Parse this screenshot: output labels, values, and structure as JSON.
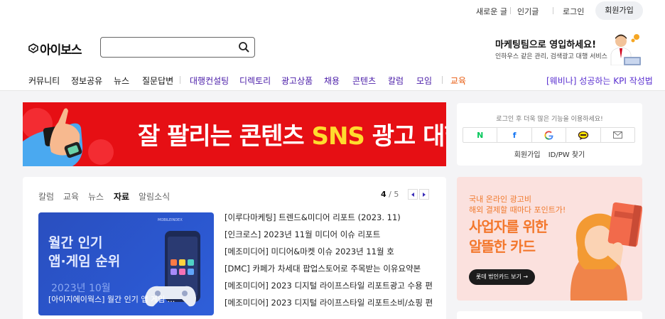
{
  "util": {
    "new_posts": "새로운 글",
    "popular": "인기글",
    "login": "로그인",
    "join": "회원가입"
  },
  "header": {
    "logo": "아이보스",
    "search_placeholder": "",
    "promo_title": "마케팅팀으로 영입하세요!",
    "promo_sub": "인하우스 같은 관리, 검색광고 대행 서비스"
  },
  "nav": {
    "items": [
      "커뮤니티",
      "정보공유",
      "뉴스",
      "질문답변",
      "대행컨설팅",
      "디렉토리",
      "광고상품",
      "채용",
      "콘텐츠",
      "칼럼",
      "모임",
      "교육"
    ],
    "right": "[웨비나] 성공하는 KPI 작성법"
  },
  "banner": {
    "text_main": "잘 팔리는 콘텐츠 ",
    "text_sns": "SNS",
    "text_end": " 광고 대행"
  },
  "loginbox": {
    "message": "로그인 후 더욱 많은 기능을 이용하세요!",
    "join": "회원가입",
    "find": "ID/PW 찾기",
    "naver": "N",
    "facebook": "f"
  },
  "content": {
    "tabs": [
      "칼럼",
      "교육",
      "뉴스",
      "자료",
      "알림소식"
    ],
    "active_tab": "자료",
    "page_current": "4",
    "page_sep": " / ",
    "page_total": "5",
    "thumb": {
      "line1": "월간 인기",
      "line2": "앱·게임 순위",
      "line3": "2023년 10월",
      "caption": "[아이지에이웍스] 월간 인기 앱 게임 ...",
      "mini": "MOBILEINDEX"
    },
    "list": [
      "[이루다마케팅] 트렌드&미디어 리포트 (2023. 11)",
      "[인크로스] 2023년 11월 미디어 이슈 리포트",
      "[메조미디어] 미디어&마켓 이슈 2023년 11월 호",
      "[DMC] 카페가 차세대 팝업스토어로 주목받는 이유요약본",
      "[메조미디어] 2023 디지털 라이프스타일 리포트광고 수용 편",
      "[메조미디어] 2023 디지털 라이프스타일 리포트소비/쇼핑 편"
    ]
  },
  "sidead": {
    "line1": "국내 온라인 광고비",
    "line2": "해외 결제할 때마다 포인트가!",
    "big1": "사업자를 위한",
    "big2": "알뜰한 카드",
    "button": "롯데 법인카드 보기 →"
  },
  "colors": {
    "banner_red": "#e60f14",
    "sns_yellow": "#ffdc2e",
    "nav_purple": "#4a1ca8",
    "nav_orange": "#e8590c",
    "ad_orange": "#f3772c"
  }
}
